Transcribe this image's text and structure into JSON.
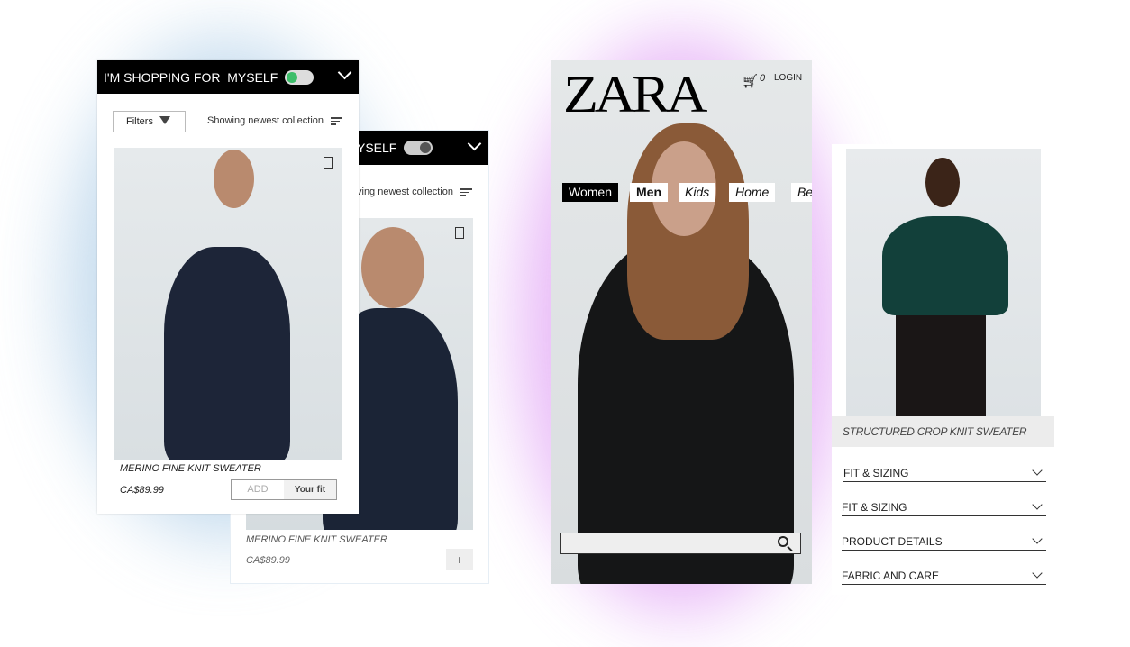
{
  "shopping_panel": {
    "header": "I'M SHOPPING FOR  MYSELF",
    "toggle_on": true,
    "toggle_color": "#3dbe6a",
    "filters_label": "Filters",
    "sort_label": "Showing newest collection",
    "product": {
      "title": "MERINO FINE KNIT SWEATER",
      "price": "CA$89.99",
      "add_label": "ADD",
      "fit_label": "Your fit"
    }
  },
  "shopping_panel_back": {
    "header": "YSELF",
    "toggle_on": false,
    "sort_label": "ving newest collection",
    "product": {
      "title": "MERINO FINE KNIT SWEATER",
      "price": "CA$89.99",
      "add_label": "+"
    }
  },
  "zara_panel": {
    "logo": "ZARA",
    "cart_count": "0",
    "login_label": "LOGIN",
    "tabs": [
      {
        "label": "Women",
        "active": true
      },
      {
        "label": "Men"
      },
      {
        "label": "Kids"
      },
      {
        "label": "Home"
      },
      {
        "label": "Be"
      }
    ],
    "search_placeholder": ""
  },
  "product_panel": {
    "title": "STRUCTURED CROP KNIT SWEATER",
    "accordions": [
      "FIT & SIZING",
      "FIT & SIZING",
      "PRODUCT DETAILS",
      "FABRIC AND CARE"
    ]
  },
  "colors": {
    "blue_glow": "#9ec3e3",
    "purple_glow": "#d58cf0"
  }
}
